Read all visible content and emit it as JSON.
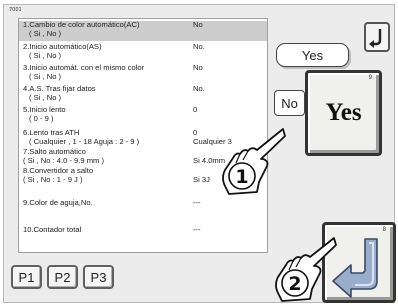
{
  "screen_id": "7001",
  "settings": [
    {
      "name": "1.Cambio de color automático(AC)",
      "sub": "( Si , No )",
      "value": "No"
    },
    {
      "name": "2.Inicio automático(AS)",
      "sub": "( Si , No )",
      "value": "No."
    },
    {
      "name": "3.Inicio automát. con el mismo color",
      "sub": "( Si , No )",
      "value": "No"
    },
    {
      "name": "4.A.S. Tras fijar datos",
      "sub": "( Si , No )",
      "value": "No."
    },
    {
      "name": "5.Inicio lento",
      "sub": "( 0 - 9 )",
      "value": "0"
    },
    {
      "name": "6.Lento tras ATH",
      "sub": "( Cualquier , 1 - 18 Aguja : 2 - 9 )",
      "value_top": "0",
      "value": "Cualquier 3"
    },
    {
      "name": "7.Salto automático",
      "sub": "( Si , No : 4.0 - 9.9 mm )",
      "value": "Si 4.0mm"
    },
    {
      "name": "8.Convertidor a salto",
      "sub": "( Si , No : 1 - 9 J )",
      "value": "Si 3J"
    },
    {
      "name": "9.Color de aguja,No.",
      "value": "---"
    },
    {
      "name": "10.Contador total",
      "value": "---"
    }
  ],
  "buttons": {
    "yes_small": "Yes",
    "no_small": "No",
    "yes_big": "Yes",
    "yes_big_corner": "9",
    "enter_corner": "8"
  },
  "tabs": [
    "P1",
    "P2",
    "P3"
  ],
  "callouts": [
    "1",
    "2"
  ],
  "icons": {
    "reset": "undo-arrow-icon",
    "enter": "enter-return-icon",
    "pointer": "pointing-hand-icon"
  }
}
